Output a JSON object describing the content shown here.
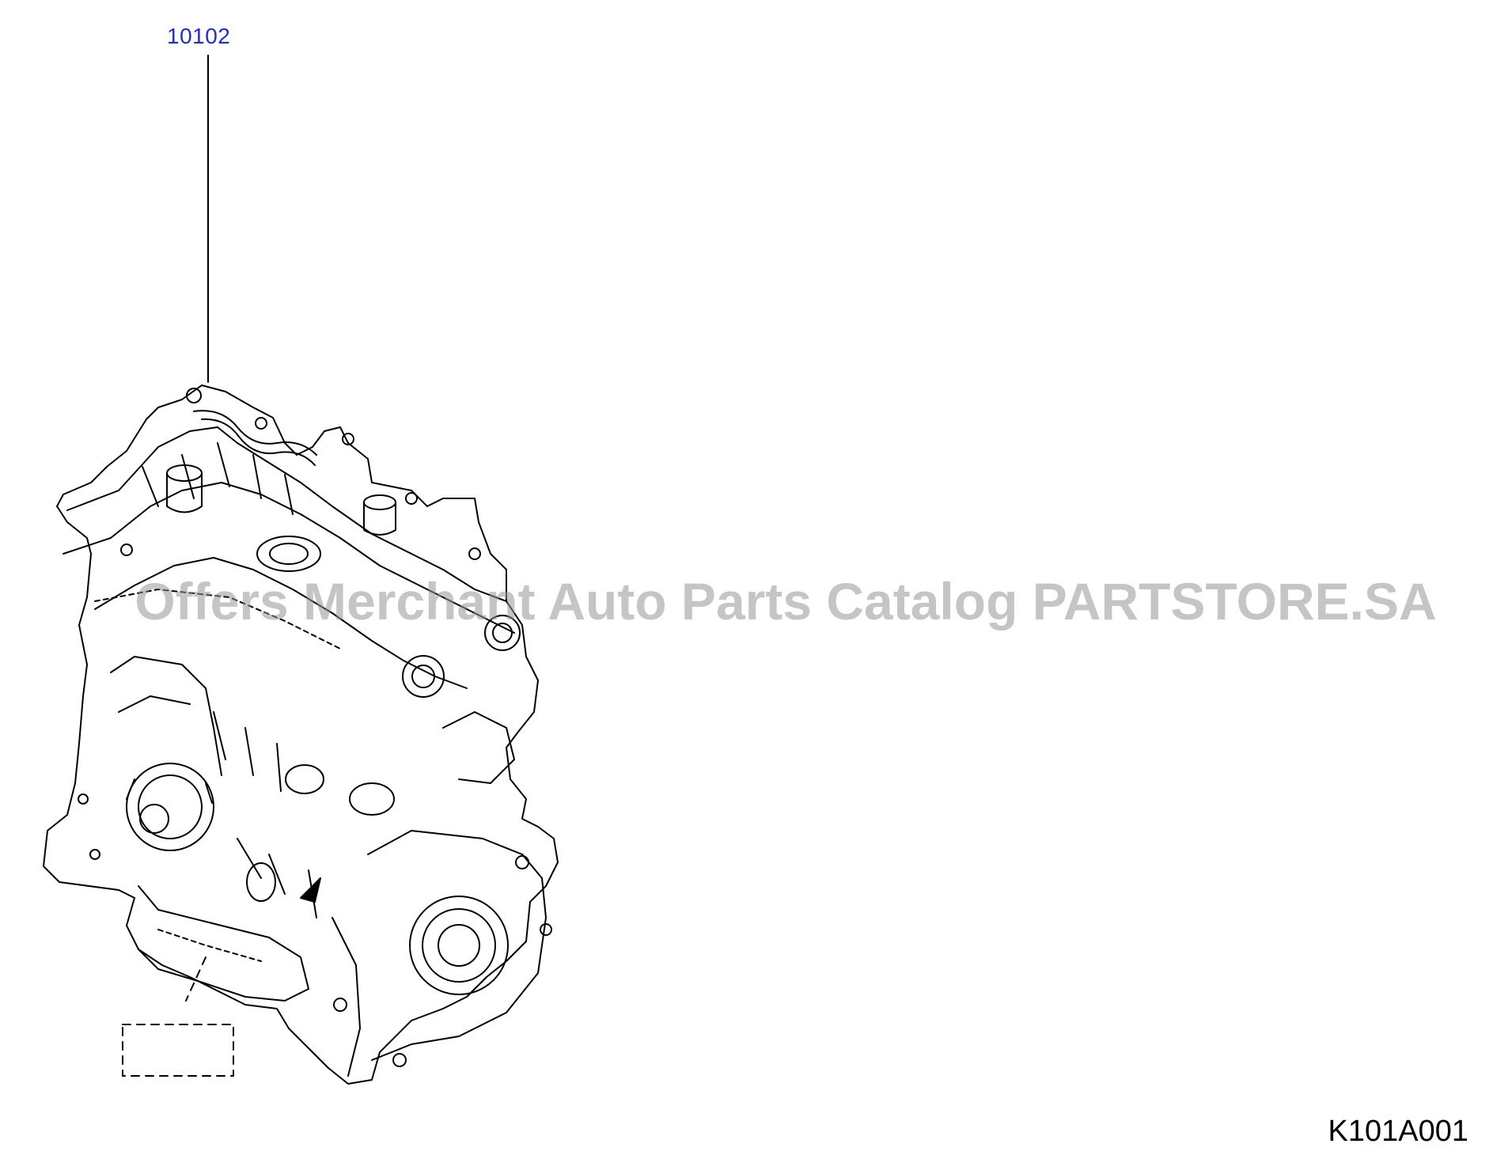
{
  "diagram": {
    "callout": "10102",
    "figure_code": "K101A001",
    "watermark": "Offers Merchant Auto Parts Catalog PARTSTORE.SA",
    "colors": {
      "callout": "#1f2fd1",
      "line": "#000000",
      "watermark": "#969696"
    }
  }
}
